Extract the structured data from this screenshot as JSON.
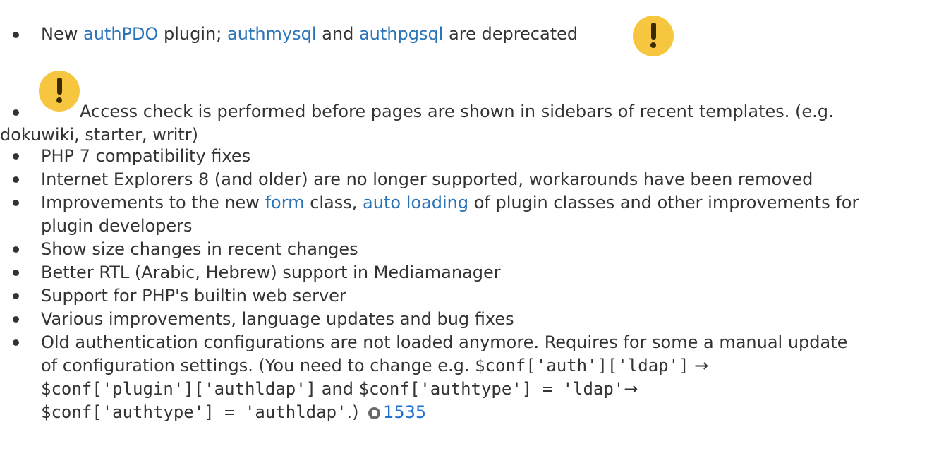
{
  "items": [
    {
      "new": "New",
      "authpdo": "authPDO",
      "plugin": "plugin;",
      "authmysql": "authmysql",
      "and": "and",
      "authpgsql": "authpgsql",
      "deprecated": "are deprecated"
    },
    {
      "line1": "Access check is performed before pages are shown in sidebars of recent templates. (e.g.",
      "line2": "dokuwiki, starter, writr)"
    },
    {
      "text": "PHP 7 compatibility fixes"
    },
    {
      "text": "Internet Explorers 8 (and older) are no longer supported, workarounds have been removed"
    },
    {
      "pre": "Improvements to the new",
      "form": "form",
      "mid": "class,",
      "autoloading": "auto loading",
      "post": "of plugin classes and other improvements for",
      "line2": "plugin developers"
    },
    {
      "text": "Show size changes in recent changes"
    },
    {
      "text": "Better RTL (Arabic, Hebrew) support in Mediamanager"
    },
    {
      "text": "Support for PHP's builtin web server"
    },
    {
      "text": "Various improvements, language updates and bug fixes"
    },
    {
      "line1": "Old authentication configurations are not loaded anymore. Requires for some a manual update",
      "line2_pre": "of configuration settings. (You need to change e.g.",
      "code1": "$conf['auth']['ldap']",
      "arrow": "→",
      "code2": "$conf['plugin']['authldap']",
      "and": "and",
      "code3": "$conf['authtype'] = 'ldap'",
      "code4": "$conf['authtype'] = 'authldap'",
      "close": ".)",
      "bug": "1535"
    }
  ],
  "icons": {
    "warning": "warning-icon",
    "bug": "bug-icon"
  },
  "colors": {
    "link": "#2b73b7",
    "warning": "#f7c640",
    "text": "#333333"
  }
}
